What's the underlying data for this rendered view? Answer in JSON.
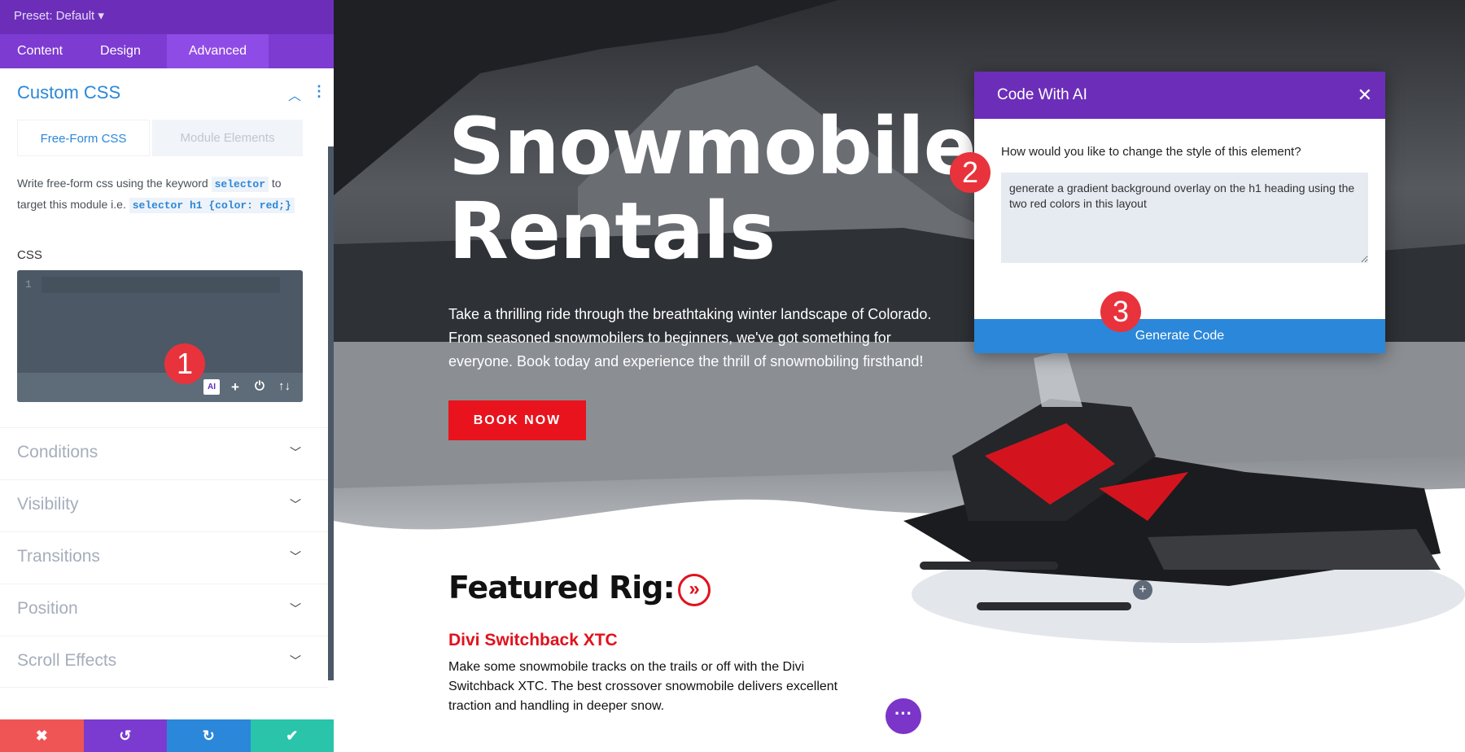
{
  "panel": {
    "preset": "Preset: Default ▾",
    "tabs": [
      "Content",
      "Design",
      "Advanced"
    ],
    "section_title": "Custom CSS",
    "subtabs": [
      "Free-Form CSS",
      "Module Elements"
    ],
    "desc_1": "Write free-form css using the keyword ",
    "desc_code1": "selector",
    "desc_2": " to target this module i.e. ",
    "desc_code2": "selector h1 {color: red;}",
    "css_label": "CSS",
    "line_number": "1",
    "ai_label": "AI",
    "sections": [
      "Conditions",
      "Visibility",
      "Transitions",
      "Position",
      "Scroll Effects"
    ]
  },
  "badges": [
    "1",
    "2",
    "3"
  ],
  "hero": {
    "title_1": "Snowmobile",
    "title_2": "Rentals",
    "lead": "Take a thrilling ride through the breathtaking winter landscape of Colorado. From seasoned snowmobilers to beginners, we've got something for everyone. Book today and experience the thrill of snowmobiling firsthand!",
    "button": "BOOK NOW"
  },
  "featured": {
    "title": "Featured Rig:",
    "product": "Divi Switchback XTC",
    "desc": "Make some snowmobile tracks on the trails or off with the Divi Switchback XTC. The best crossover snowmobile delivers excellent traction and handling in deeper snow."
  },
  "modal": {
    "title": "Code With AI",
    "label": "How would you like to change the style of this element?",
    "prompt": "generate a gradient background overlay on the h1 heading using the two red colors in this layout",
    "button": "Generate Code"
  },
  "colors": {
    "purple": "#6c2eb9",
    "blue": "#2b87da",
    "red": "#e8131d",
    "teal": "#29c4a9"
  }
}
